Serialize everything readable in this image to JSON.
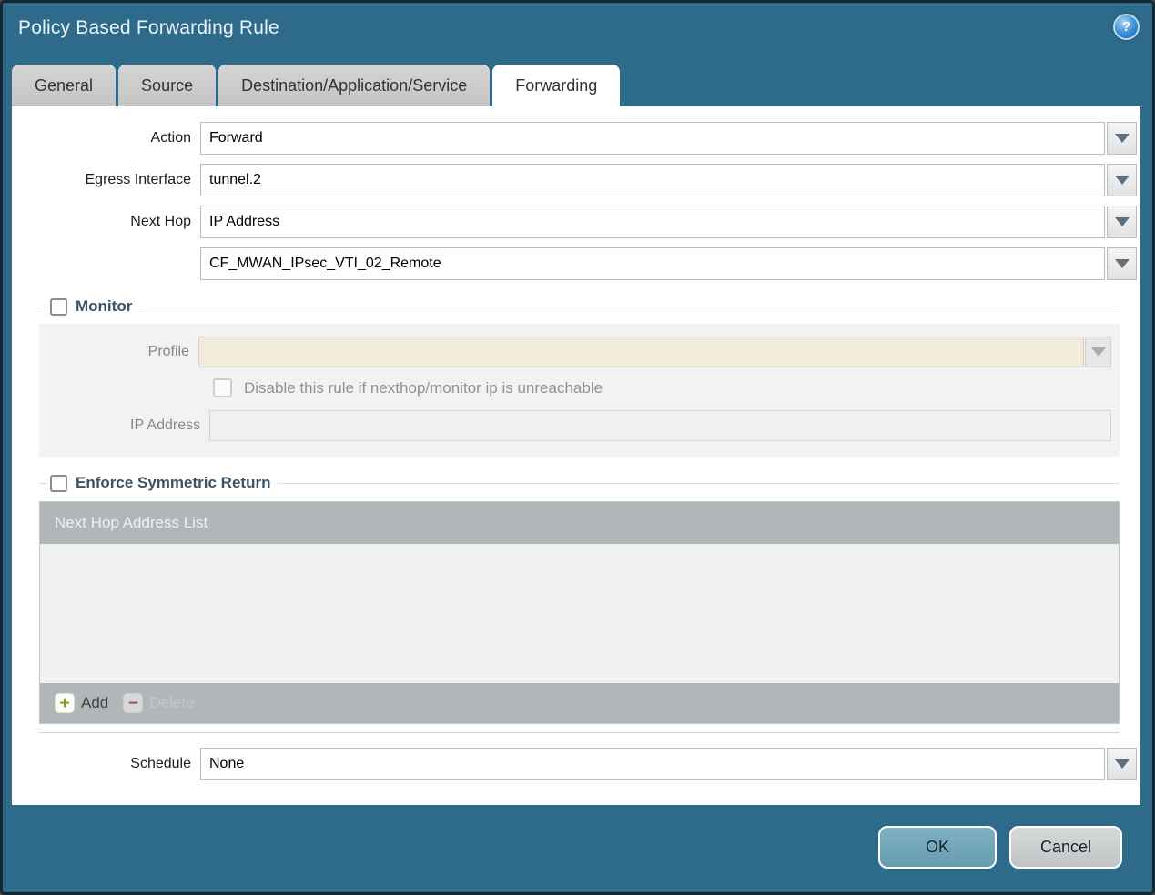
{
  "window": {
    "title": "Policy Based Forwarding Rule"
  },
  "tabs": {
    "items": [
      {
        "label": "General"
      },
      {
        "label": "Source"
      },
      {
        "label": "Destination/Application/Service"
      },
      {
        "label": "Forwarding"
      }
    ],
    "active": "Forwarding"
  },
  "form": {
    "action_label": "Action",
    "action_value": "Forward",
    "egress_label": "Egress Interface",
    "egress_value": "tunnel.2",
    "next_hop_label": "Next Hop",
    "next_hop_type_value": "IP Address",
    "next_hop_address_value": "CF_MWAN_IPsec_VTI_02_Remote",
    "schedule_label": "Schedule",
    "schedule_value": "None"
  },
  "monitor": {
    "title": "Monitor",
    "checked": false,
    "profile_label": "Profile",
    "profile_value": "",
    "disable_rule_label": "Disable this rule if nexthop/monitor ip is unreachable",
    "disable_rule_checked": false,
    "ip_address_label": "IP Address",
    "ip_address_value": ""
  },
  "symmetric_return": {
    "title": "Enforce Symmetric Return",
    "checked": false,
    "table_header": "Next Hop Address List",
    "rows": [],
    "add_label": "Add",
    "delete_label": "Delete"
  },
  "footer": {
    "ok_label": "OK",
    "cancel_label": "Cancel"
  },
  "icons": {
    "help": "?",
    "add": "+",
    "delete": "−"
  },
  "colors": {
    "titlebar_teal": "#2e6b8b",
    "active_tab": "#ffffff",
    "inactive_tab": "#c9c9c9",
    "disabled_beige": "#f1ebd9",
    "group_title": "#3c5364",
    "table_chrome": "#b1b6b9",
    "ok_button": "#74a7bc",
    "cancel_button": "#c9cccd"
  }
}
